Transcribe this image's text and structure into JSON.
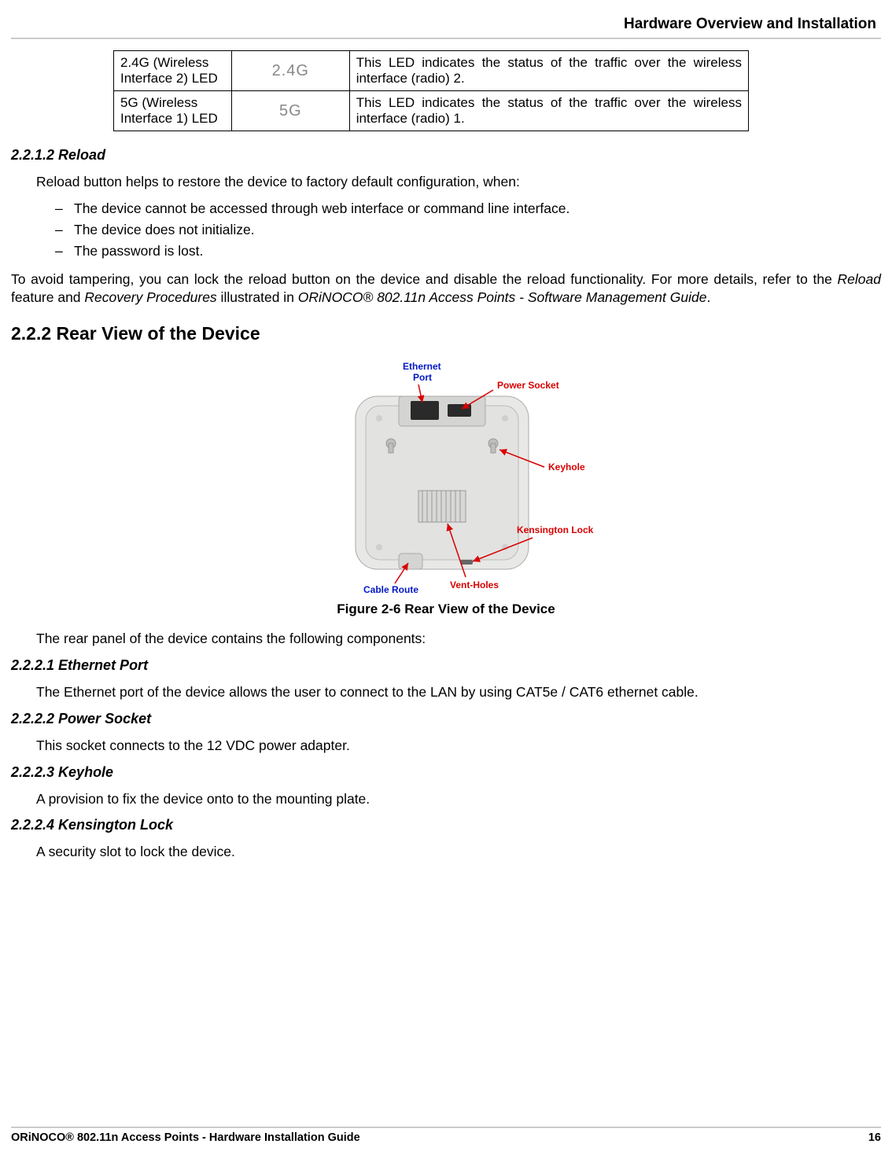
{
  "header": {
    "title": "Hardware Overview and Installation"
  },
  "led_table": {
    "rows": [
      {
        "name": "2.4G (Wireless Interface 2) LED",
        "label": "2.4G",
        "desc": "This LED indicates the status of the traffic over the wireless interface (radio) 2."
      },
      {
        "name": "5G (Wireless Interface 1) LED",
        "label": "5G",
        "desc": "This LED indicates the status of the traffic over the wireless interface (radio) 1."
      }
    ]
  },
  "sections": {
    "reload": {
      "num_title": "2.2.1.2 Reload",
      "intro": "Reload button helps to restore the device to factory default configuration, when:",
      "bullets": [
        "The device cannot be accessed through web interface or command line interface.",
        "The device does not initialize.",
        "The password is lost."
      ],
      "para_pre": "To avoid tampering, you can lock the reload button on the device and disable the reload functionality. For more details, refer to the ",
      "para_i1": "Reload",
      "para_mid1": " feature and ",
      "para_i2": "Recovery Procedures",
      "para_mid2": " illustrated in ",
      "para_i3": "ORiNOCO® 802.11n Access Points - Software Management Guide",
      "para_post": "."
    },
    "rear": {
      "title": "2.2.2 Rear View of the Device",
      "fig_caption": "Figure 2-6 Rear View of the Device",
      "labels": {
        "eth": "Ethernet\nPort",
        "power": "Power Socket",
        "keyhole": "Keyhole",
        "kens": "Kensington Lock",
        "vent": "Vent-Holes",
        "cable": "Cable Route"
      },
      "after_fig": "The rear panel of the device contains the following components:",
      "subs": [
        {
          "h": "2.2.2.1 Ethernet Port",
          "p": "The Ethernet port of the device allows the user to connect to the LAN by using CAT5e / CAT6 ethernet cable."
        },
        {
          "h": "2.2.2.2 Power Socket",
          "p": "This socket connects to the 12 VDC power adapter."
        },
        {
          "h": "2.2.2.3 Keyhole",
          "p": "A provision to fix the device onto to the mounting plate."
        },
        {
          "h": "2.2.2.4 Kensington Lock",
          "p": "A security slot to lock the device."
        }
      ]
    }
  },
  "footer": {
    "left": "ORiNOCO® 802.11n Access Points - Hardware Installation Guide",
    "right": "16"
  }
}
